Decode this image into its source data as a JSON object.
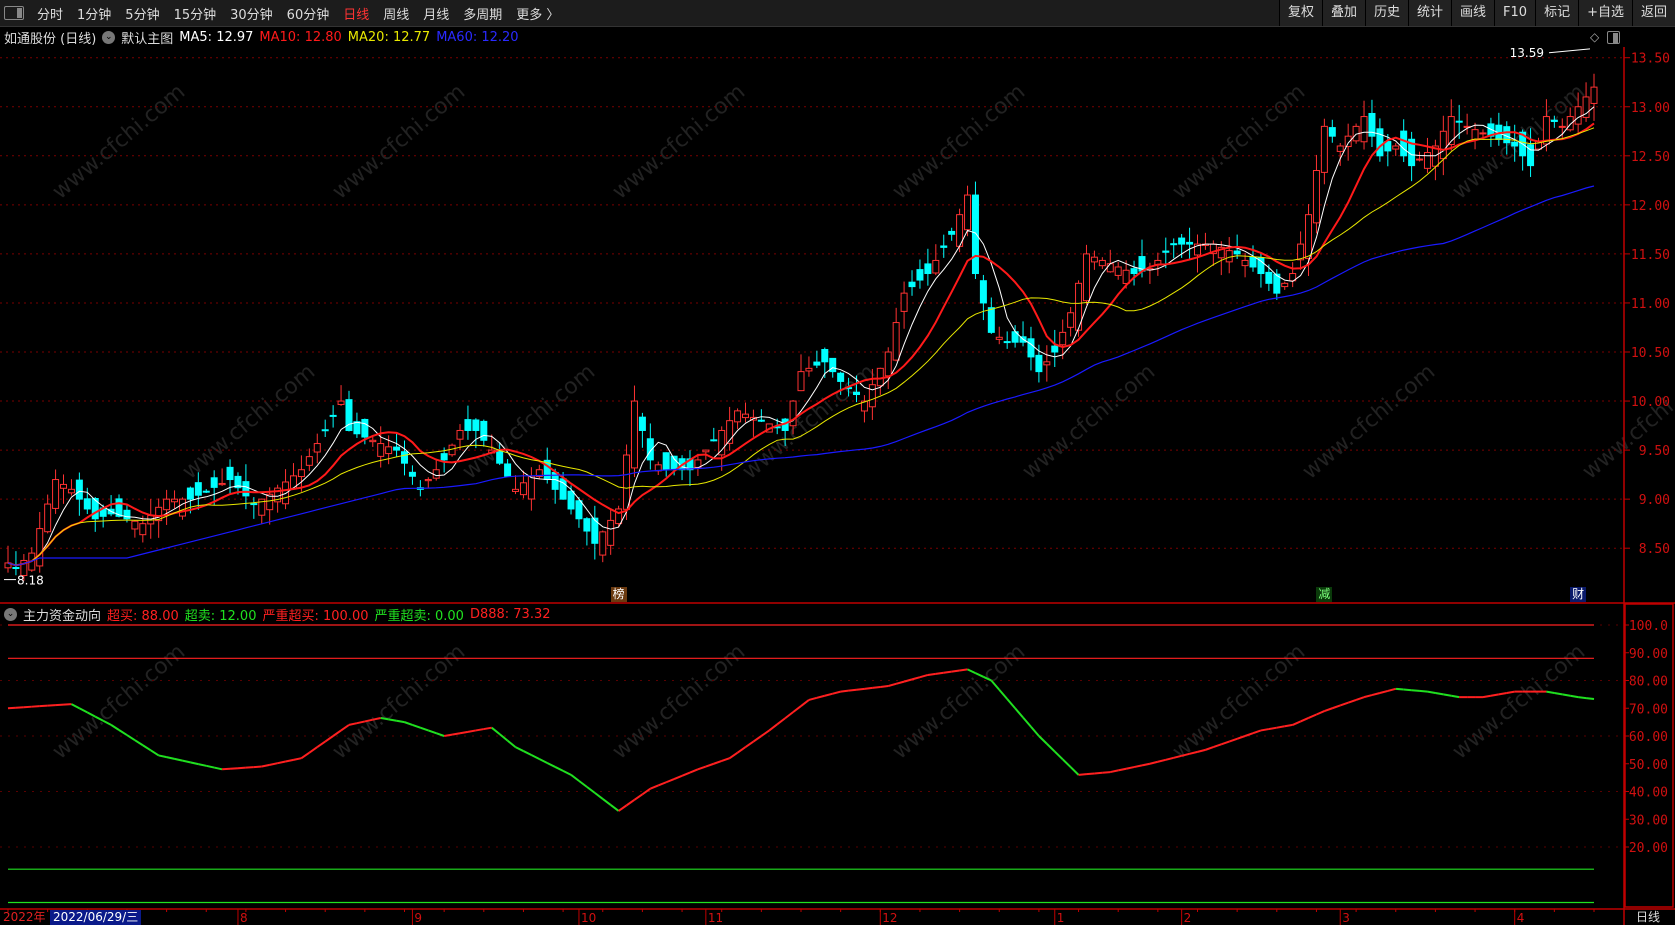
{
  "toolbar": {
    "periods": [
      "分时",
      "1分钟",
      "5分钟",
      "15分钟",
      "30分钟",
      "60分钟",
      "日线",
      "周线",
      "月线",
      "多周期",
      "更多 〉"
    ],
    "active_period": "日线",
    "buttons": [
      "复权",
      "叠加",
      "历史",
      "统计",
      "画线",
      "F10",
      "标记",
      "+自选",
      "返回"
    ]
  },
  "info": {
    "stock": "如通股份 (日线)",
    "template": "默认主图",
    "ma5": "MA5: 12.97",
    "ma10": "MA10: 12.80",
    "ma20": "MA20: 12.77",
    "ma60": "MA60: 12.20"
  },
  "indicator": {
    "name": "主力资金动向",
    "overbuy": "超买: 88.00",
    "oversell": "超卖: 12.00",
    "severe_overbuy": "严重超买: 100.00",
    "severe_oversell": "严重超卖: 0.00",
    "d888": "D888: 73.32"
  },
  "colors": {
    "up": "#ff3232",
    "down": "#00ffff",
    "ma5": "#ffffff",
    "ma10": "#ff1a1a",
    "ma20": "#e8e800",
    "ma60": "#1a1aff",
    "axis": "#c00000",
    "ind_up": "#ff2020",
    "ind_down": "#20e020"
  },
  "xaxis": {
    "year": "2022年",
    "cursor_date": "2022/06/29/三",
    "months": [
      {
        "label": "8",
        "day": 29
      },
      {
        "label": "9",
        "day": 51
      },
      {
        "label": "10",
        "day": 72
      },
      {
        "label": "11",
        "day": 88
      },
      {
        "label": "12",
        "day": 110
      },
      {
        "label": "1",
        "day": 132
      },
      {
        "label": "2",
        "day": 148
      },
      {
        "label": "3",
        "day": 168
      },
      {
        "label": "4",
        "day": 190
      }
    ],
    "period": "日线"
  },
  "markers": [
    {
      "label": "榜",
      "day": 77,
      "bg": "#6b3a10",
      "color": "#fff"
    },
    {
      "label": "减",
      "day": 166,
      "bg": "#0a3a0a",
      "color": "#7cff7c"
    },
    {
      "label": "财",
      "day": 198,
      "bg": "#0a1a6a",
      "color": "#fff"
    }
  ],
  "annotations": {
    "high": "13.59",
    "low": "8.18"
  },
  "watermark": "www.cfchi.com",
  "chart_data": [
    {
      "type": "candlestick",
      "title": "如通股份 (日线)",
      "days": 201,
      "ylim": [
        8.05,
        13.65
      ],
      "yticks": [
        "13.50",
        "13.00",
        "12.50",
        "12.00",
        "11.50",
        "11.00",
        "10.50",
        "10.00",
        "9.50",
        "9.00",
        "8.50"
      ],
      "close_keypoints": [
        [
          0,
          8.35
        ],
        [
          1,
          8.3
        ],
        [
          3,
          8.45
        ],
        [
          6,
          9.2
        ],
        [
          8,
          9.1
        ],
        [
          11,
          8.8
        ],
        [
          13,
          8.85
        ],
        [
          17,
          8.75
        ],
        [
          20,
          9.0
        ],
        [
          23,
          9.0
        ],
        [
          28,
          9.2
        ],
        [
          31,
          8.95
        ],
        [
          33,
          9.05
        ],
        [
          37,
          9.3
        ],
        [
          40,
          9.7
        ],
        [
          42,
          10.0
        ],
        [
          43,
          9.7
        ],
        [
          46,
          9.6
        ],
        [
          49,
          9.5
        ],
        [
          52,
          9.1
        ],
        [
          55,
          9.4
        ],
        [
          57,
          9.7
        ],
        [
          59,
          9.7
        ],
        [
          61,
          9.5
        ],
        [
          64,
          9.1
        ],
        [
          67,
          9.3
        ],
        [
          69,
          9.1
        ],
        [
          72,
          8.8
        ],
        [
          74,
          8.55
        ],
        [
          77,
          8.9
        ],
        [
          79,
          10.0
        ],
        [
          81,
          9.4
        ],
        [
          83,
          9.3
        ],
        [
          86,
          9.3
        ],
        [
          89,
          9.6
        ],
        [
          92,
          9.9
        ],
        [
          95,
          9.8
        ],
        [
          98,
          9.7
        ],
        [
          100,
          10.3
        ],
        [
          103,
          10.4
        ],
        [
          105,
          10.2
        ],
        [
          108,
          10.0
        ],
        [
          111,
          10.5
        ],
        [
          113,
          11.1
        ],
        [
          116,
          11.3
        ],
        [
          119,
          11.7
        ],
        [
          121,
          12.1
        ],
        [
          122,
          11.3
        ],
        [
          124,
          10.7
        ],
        [
          126,
          10.6
        ],
        [
          128,
          10.6
        ],
        [
          130,
          10.3
        ],
        [
          132,
          10.5
        ],
        [
          134,
          10.9
        ],
        [
          136,
          11.5
        ],
        [
          139,
          11.4
        ],
        [
          142,
          11.3
        ],
        [
          144,
          11.35
        ],
        [
          147,
          11.6
        ],
        [
          150,
          11.6
        ],
        [
          152,
          11.6
        ],
        [
          155,
          11.5
        ],
        [
          158,
          11.3
        ],
        [
          160,
          11.1
        ],
        [
          162,
          11.3
        ],
        [
          164,
          11.9
        ],
        [
          166,
          12.8
        ],
        [
          168,
          12.6
        ],
        [
          171,
          12.9
        ],
        [
          173,
          12.5
        ],
        [
          175,
          12.6
        ],
        [
          177,
          12.4
        ],
        [
          180,
          12.6
        ],
        [
          182,
          12.9
        ],
        [
          184,
          12.8
        ],
        [
          187,
          12.7
        ],
        [
          190,
          12.6
        ],
        [
          192,
          12.4
        ],
        [
          194,
          12.9
        ],
        [
          196,
          12.8
        ],
        [
          198,
          13.0
        ],
        [
          200,
          13.2
        ]
      ],
      "ma_periods": [
        5,
        10,
        20,
        60
      ],
      "high": 13.59,
      "low": 8.18
    },
    {
      "type": "line",
      "title": "主力资金动向",
      "ylim": [
        0,
        105
      ],
      "yticks": [
        "100.0",
        "90.00",
        "80.00",
        "70.00",
        "60.00",
        "50.00",
        "40.00",
        "30.00",
        "20.00"
      ],
      "levels": {
        "severe_overbuy": 100,
        "overbuy": 88,
        "oversell": 12,
        "severe_oversell": 0
      },
      "d888_keypoints": [
        [
          0,
          70
        ],
        [
          8,
          71.5
        ],
        [
          13,
          64
        ],
        [
          19,
          53
        ],
        [
          27,
          48
        ],
        [
          32,
          49
        ],
        [
          37,
          52
        ],
        [
          43,
          64
        ],
        [
          47,
          66.5
        ],
        [
          50,
          65
        ],
        [
          55,
          60
        ],
        [
          59,
          62
        ],
        [
          61,
          63
        ],
        [
          64,
          56
        ],
        [
          71,
          46
        ],
        [
          77,
          33
        ],
        [
          81,
          41
        ],
        [
          87,
          48
        ],
        [
          91,
          52
        ],
        [
          96,
          62
        ],
        [
          101,
          73
        ],
        [
          105,
          76
        ],
        [
          111,
          78
        ],
        [
          116,
          82
        ],
        [
          121,
          84
        ],
        [
          124,
          80
        ],
        [
          130,
          60
        ],
        [
          135,
          46
        ],
        [
          139,
          47
        ],
        [
          144,
          50
        ],
        [
          151,
          55
        ],
        [
          158,
          62
        ],
        [
          162,
          64
        ],
        [
          166,
          69
        ],
        [
          171,
          74
        ],
        [
          175,
          77
        ],
        [
          179,
          76
        ],
        [
          183,
          74
        ],
        [
          186,
          74
        ],
        [
          190,
          76
        ],
        [
          194,
          76
        ],
        [
          198,
          74
        ],
        [
          200,
          73.32
        ]
      ]
    }
  ]
}
